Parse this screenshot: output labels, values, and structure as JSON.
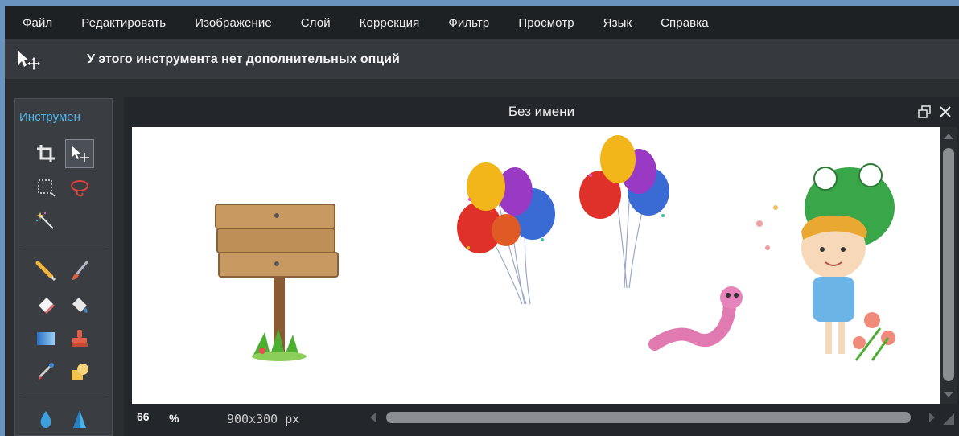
{
  "menubar": {
    "items": [
      "Файл",
      "Редактировать",
      "Изображение",
      "Слой",
      "Коррекция",
      "Фильтр",
      "Просмотр",
      "Язык",
      "Справка"
    ]
  },
  "options_bar": {
    "active_tool_icon": "move-tool-icon",
    "message": "У этого инструмента нет дополнительных опций"
  },
  "tools_panel": {
    "title": "Инструмен",
    "tools": [
      {
        "name": "crop-tool",
        "icon": "crop-icon",
        "selected": false
      },
      {
        "name": "move-tool",
        "icon": "move-icon",
        "selected": true
      },
      {
        "name": "marquee-tool",
        "icon": "marquee-icon",
        "selected": false
      },
      {
        "name": "lasso-tool",
        "icon": "lasso-icon",
        "selected": false
      },
      {
        "name": "magic-wand-tool",
        "icon": "magic-wand-icon",
        "selected": false
      },
      {
        "name": "pencil-tool",
        "icon": "pencil-icon",
        "selected": false
      },
      {
        "name": "brush-tool",
        "icon": "brush-icon",
        "selected": false
      },
      {
        "name": "eraser-tool",
        "icon": "eraser-icon",
        "selected": false
      },
      {
        "name": "paint-bucket-tool",
        "icon": "paint-bucket-icon",
        "selected": false
      },
      {
        "name": "gradient-tool",
        "icon": "gradient-icon",
        "selected": false
      },
      {
        "name": "stamp-tool",
        "icon": "stamp-icon",
        "selected": false
      },
      {
        "name": "color-replace-tool",
        "icon": "color-replace-icon",
        "selected": false
      },
      {
        "name": "shape-tool",
        "icon": "shape-icon",
        "selected": false
      },
      {
        "name": "drop-tool",
        "icon": "blur-drop-icon",
        "selected": false
      },
      {
        "name": "sharpen-tool",
        "icon": "sharpen-icon",
        "selected": false
      }
    ]
  },
  "document": {
    "title": "Без имени",
    "zoom_value": "66",
    "zoom_unit": "%",
    "size": "900x300 px"
  },
  "colors": {
    "menubar_bg": "#1e2124",
    "panel_bg": "#3a3e42",
    "accent": "#4fb3e6",
    "canvas_bg": "#ffffff"
  }
}
